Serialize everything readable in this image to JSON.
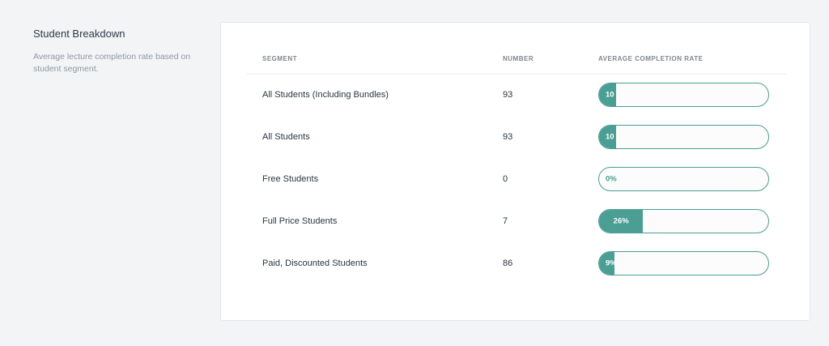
{
  "intro": {
    "title": "Student Breakdown",
    "description": "Average lecture completion rate based on student segment."
  },
  "table": {
    "headers": {
      "segment": "SEGMENT",
      "number": "NUMBER",
      "rate": "AVERAGE COMPLETION RATE"
    },
    "rows": [
      {
        "segment": "All Students (Including Bundles)",
        "number": "93",
        "rate_label": "10",
        "rate_fraction": 0.1
      },
      {
        "segment": "All Students",
        "number": "93",
        "rate_label": "10",
        "rate_fraction": 0.1
      },
      {
        "segment": "Free Students",
        "number": "0",
        "rate_label": "0%",
        "rate_fraction": 0
      },
      {
        "segment": "Full Price Students",
        "number": "7",
        "rate_label": "26%",
        "rate_fraction": 0.26
      },
      {
        "segment": "Paid, Discounted Students",
        "number": "86",
        "rate_label": "9%",
        "rate_fraction": 0.09
      }
    ]
  },
  "colors": {
    "accent": "#4a9e93",
    "bar_background": "#fbfcfb",
    "page_background": "#f3f4f6"
  }
}
